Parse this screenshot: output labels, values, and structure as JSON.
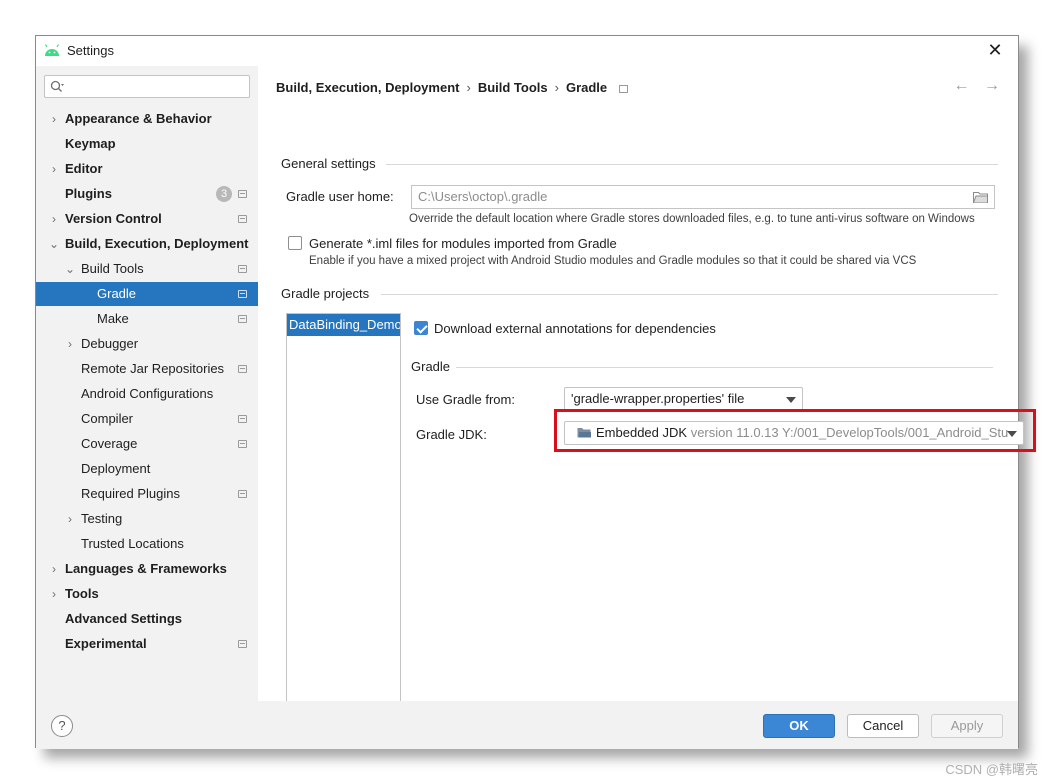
{
  "window": {
    "title": "Settings",
    "close_glyph": "✕"
  },
  "sidebar": {
    "search": {
      "placeholder": "",
      "value": ""
    },
    "items": [
      {
        "label": "Appearance & Behavior",
        "bold": true,
        "chevron": "›",
        "level": 0
      },
      {
        "label": "Keymap",
        "bold": true,
        "level": 0
      },
      {
        "label": "Editor",
        "bold": true,
        "chevron": "›",
        "level": 0
      },
      {
        "label": "Plugins",
        "bold": true,
        "level": 0,
        "badge": "3"
      },
      {
        "label": "Version Control",
        "bold": true,
        "chevron": "›",
        "level": 0
      },
      {
        "label": "Build, Execution, Deployment",
        "bold": true,
        "chevron": "⌄",
        "level": 0
      },
      {
        "label": "Build Tools",
        "chevron": "⌄",
        "level": 1
      },
      {
        "label": "Gradle",
        "level": 2,
        "selected": true
      },
      {
        "label": "Make",
        "level": 2
      },
      {
        "label": "Debugger",
        "chevron": "›",
        "level": 1
      },
      {
        "label": "Remote Jar Repositories",
        "level": 1
      },
      {
        "label": "Android Configurations",
        "level": 1
      },
      {
        "label": "Compiler",
        "level": 1
      },
      {
        "label": "Coverage",
        "level": 1
      },
      {
        "label": "Deployment",
        "level": 1
      },
      {
        "label": "Required Plugins",
        "level": 1
      },
      {
        "label": "Testing",
        "chevron": "›",
        "level": 1
      },
      {
        "label": "Trusted Locations",
        "level": 1
      },
      {
        "label": "Languages & Frameworks",
        "bold": true,
        "chevron": "›",
        "level": 0
      },
      {
        "label": "Tools",
        "bold": true,
        "chevron": "›",
        "level": 0
      },
      {
        "label": "Advanced Settings",
        "bold": true,
        "level": 0
      },
      {
        "label": "Experimental",
        "bold": true,
        "level": 0
      }
    ]
  },
  "breadcrumb": {
    "parts": [
      "Build, Execution, Deployment",
      "Build Tools",
      "Gradle"
    ],
    "separator": "›",
    "back_glyph": "←",
    "forward_glyph": "→"
  },
  "general": {
    "title": "General settings",
    "user_home_label": "Gradle user home:",
    "user_home_value": "C:\\Users\\octop\\.gradle",
    "user_home_hint": "Override the default location where Gradle stores downloaded files, e.g. to tune anti-virus software on Windows",
    "iml_label": "Generate *.iml files for modules imported from Gradle",
    "iml_checked": false,
    "iml_hint": "Enable if you have a mixed project with Android Studio modules and Gradle modules so that it could be shared via VCS"
  },
  "projects": {
    "title": "Gradle projects",
    "items": [
      "DataBinding_Demo"
    ],
    "download_annotations_label": "Download external annotations for dependencies",
    "download_annotations_checked": true,
    "gradle_section_title": "Gradle",
    "use_gradle_from_label": "Use Gradle from:",
    "use_gradle_from_value": "'gradle-wrapper.properties' file",
    "jdk_label": "Gradle JDK:",
    "jdk_name": "Embedded JDK",
    "jdk_detail": "version 11.0.13 Y:/001_DevelopTools/001_Android_Stu"
  },
  "footer": {
    "help": "?",
    "ok": "OK",
    "cancel": "Cancel",
    "apply": "Apply"
  },
  "watermark": "CSDN @韩曙亮",
  "colors": {
    "selection": "#2675bf",
    "primary_button": "#3c86d6",
    "highlight_box": "#d9101c",
    "checkbox_checked": "#3d85d1"
  }
}
